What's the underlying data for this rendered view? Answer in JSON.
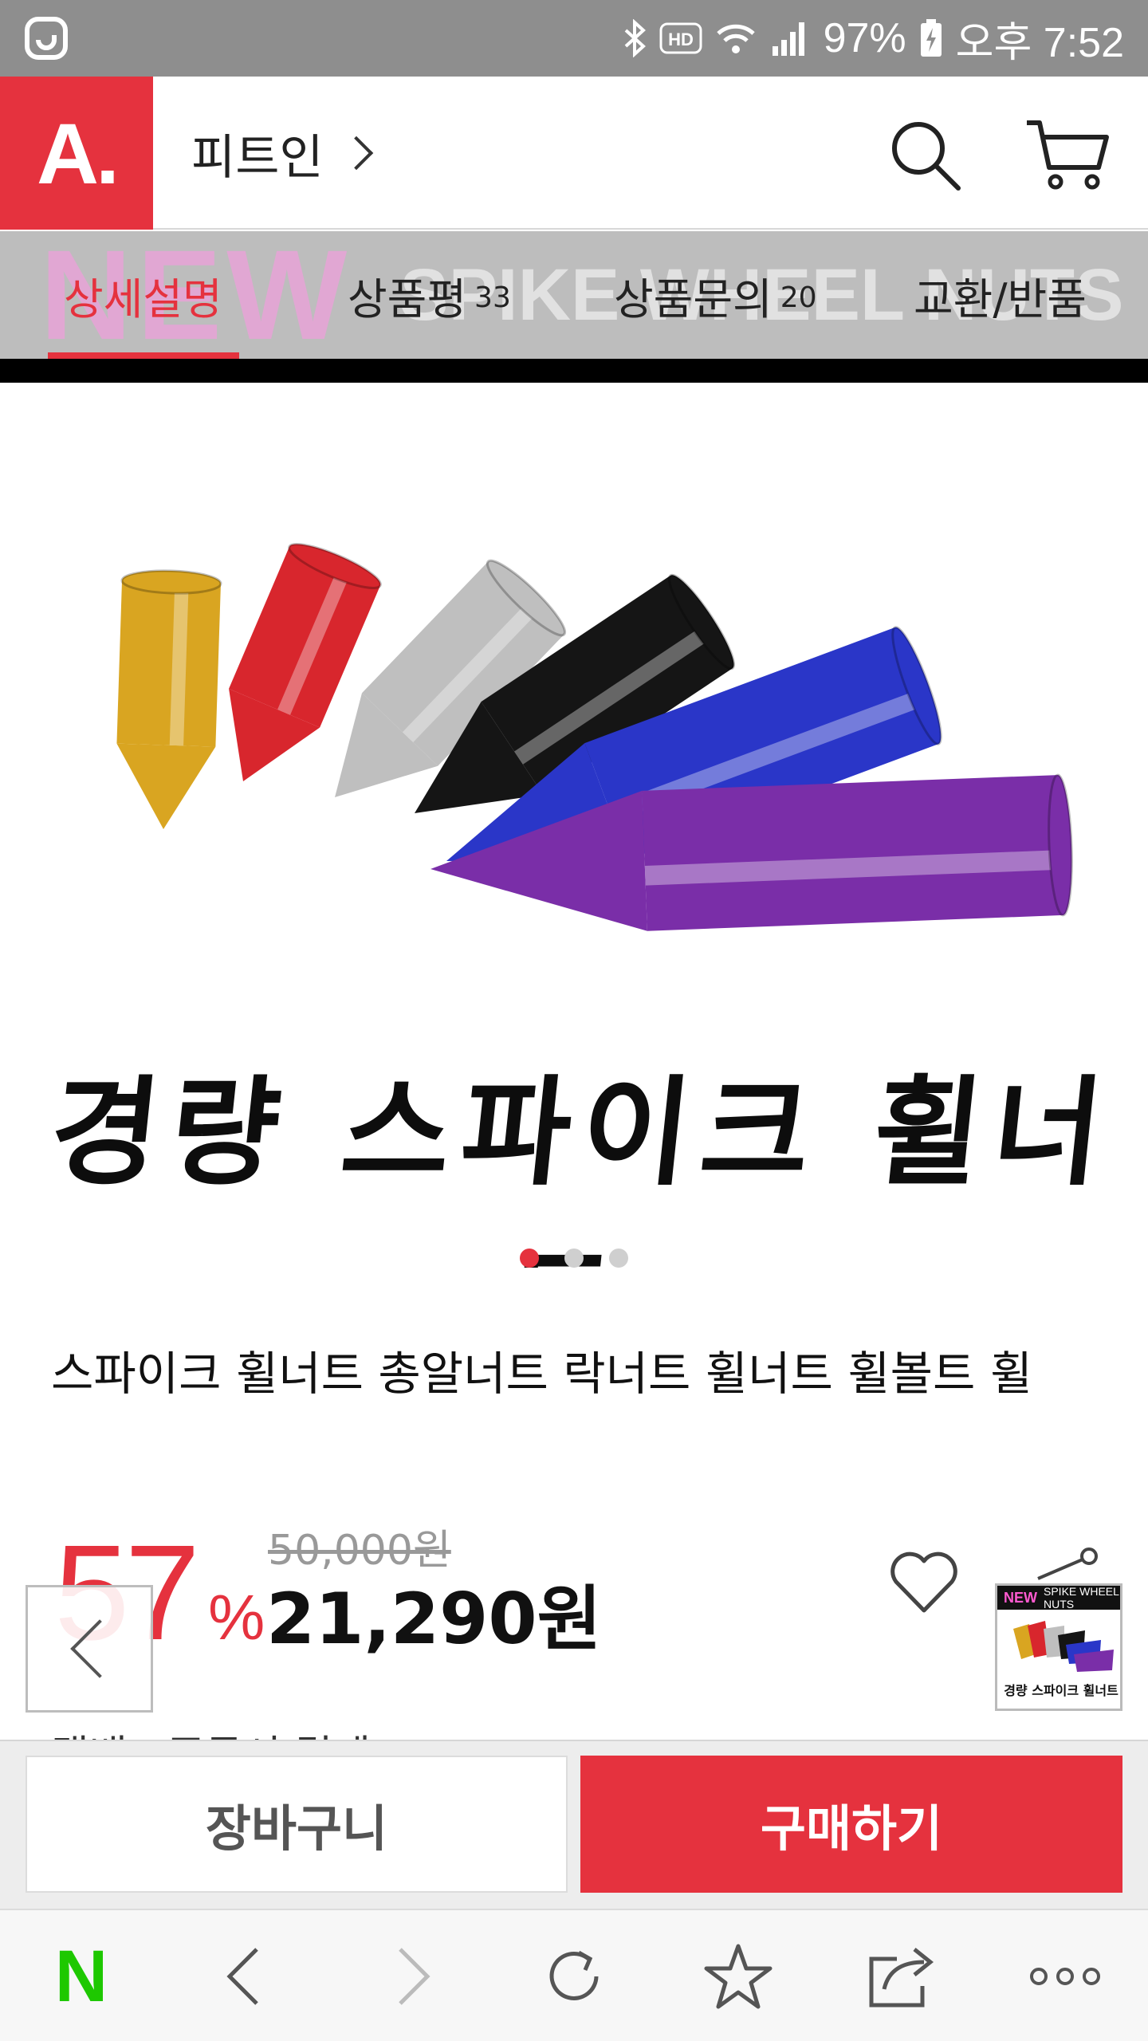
{
  "status_bar": {
    "battery": "97%",
    "time": "오후 7:52",
    "icons": [
      "app-notification-icon",
      "bluetooth-icon",
      "hd-icon",
      "wifi-icon",
      "signal-icon",
      "battery-charging-icon"
    ]
  },
  "header": {
    "logo": "A.",
    "shop_name": "피트인",
    "icons": [
      "search-icon",
      "cart-icon"
    ]
  },
  "tabs": [
    {
      "label": "상세설명",
      "count": "",
      "active": true
    },
    {
      "label": "상품평",
      "count": "33",
      "active": false
    },
    {
      "label": "상품문의",
      "count": "20",
      "active": false
    },
    {
      "label": "교환/반품",
      "count": "",
      "active": false
    }
  ],
  "tab_banner_text": {
    "neon": "NEW",
    "rest": "SPIKE WHEEL NUTS"
  },
  "product_image": {
    "hero_text": "경량 스파이크 휠너트",
    "nut_colors": [
      "#d9a521",
      "#d8262d",
      "#bfbfbf",
      "#151515",
      "#2a36c8",
      "#7a2ea8"
    ],
    "slides": 3,
    "active_slide": 1
  },
  "product": {
    "title": "스파이크 휠너트 총알너트 락너트 휠너트 휠볼트 휠",
    "discount_number": "57",
    "discount_unit": "%",
    "original_price": "50,000원",
    "sale_price": "21,290원",
    "shipping_peek": "택배 · 주문시 결제"
  },
  "thumbnail": {
    "banner_new": "NEW",
    "banner_rest": "SPIKE WHEEL NUTS",
    "caption": "경량 스파이크 휠너트"
  },
  "actions": {
    "cart_label": "장바구니",
    "buy_label": "구매하기"
  },
  "browser_nav": {
    "home_label": "N",
    "icons": [
      "naver-home-icon",
      "back-icon",
      "forward-icon",
      "refresh-icon",
      "bookmark-star-icon",
      "share-icon",
      "more-icon"
    ]
  },
  "colors": {
    "accent": "#e5323e",
    "naver_green": "#1ec800",
    "status_bar": "#8e8e8e",
    "tab_bg": "#bdbdbd"
  }
}
